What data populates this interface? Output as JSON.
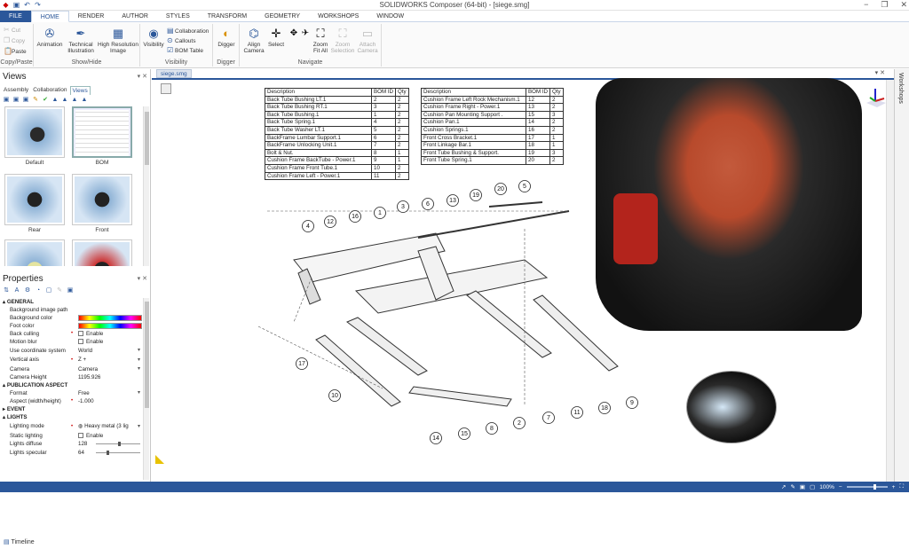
{
  "window": {
    "title": "SOLIDWORKS Composer (64-bit) - [siege.smg]",
    "minimize": "−",
    "restore": "❐",
    "close": "✕"
  },
  "ribbon_tabs": [
    "FILE",
    "HOME",
    "RENDER",
    "AUTHOR",
    "STYLES",
    "TRANSFORM",
    "GEOMETRY",
    "WORKSHOPS",
    "WINDOW"
  ],
  "ribbon": {
    "clipboard": {
      "cut": "Cut",
      "copy": "Copy",
      "paste": "Paste",
      "label": "Copy/Paste"
    },
    "showhide": {
      "animation": "Animation",
      "technical": "Technical Illustration",
      "highres": "High Resolution Image",
      "label": "Show/Hide"
    },
    "visibility": {
      "visibility": "Visibility",
      "collaboration": "Collaboration",
      "callouts": "Callouts",
      "bomtable": "BOM Table",
      "label": "Visibility"
    },
    "digger": {
      "digger": "Digger",
      "label": "Digger"
    },
    "navigate": {
      "align": "Align Camera",
      "select": "Select",
      "zoomfit": "Zoom Fit All",
      "zoomsel": "Zoom Selection",
      "attach": "Attach Camera",
      "label": "Navigate"
    }
  },
  "views_panel": {
    "title": "Views",
    "tabs": [
      "Assembly",
      "Collaboration",
      "Views"
    ],
    "thumbs": [
      "Default",
      "BOM",
      "Rear",
      "Front"
    ]
  },
  "properties": {
    "title": "Properties",
    "general": "GENERAL",
    "bg_image_path": "Background image path",
    "bg_color": "Background color",
    "foot_color": "Foot color",
    "back_culling": "Back culling",
    "back_culling_val": "Enable",
    "motion_blur": "Motion blur",
    "motion_blur_val": "Enable",
    "coord_system": "Use coordinate system",
    "coord_system_val": "World",
    "vertical_axis": "Vertical axis",
    "vertical_axis_val": "Z +",
    "camera": "Camera",
    "camera_val": "Camera",
    "camera_height": "Camera Height",
    "camera_height_val": "1195.926",
    "pub_aspect": "PUBLICATION ASPECT",
    "format": "Format",
    "format_val": "Free",
    "aspect": "Aspect (width/height)",
    "aspect_val": "-1.000",
    "event": "EVENT",
    "lights": "LIGHTS",
    "lighting_mode": "Lighting mode",
    "lighting_mode_val": "Heavy metal (3 lig",
    "static_lighting": "Static lighting",
    "static_lighting_val": "Enable",
    "lights_diffuse": "Lights diffuse",
    "lights_diffuse_val": "128",
    "lights_specular": "Lights specular",
    "lights_specular_val": "64"
  },
  "timeline": "Timeline",
  "doc_tab": "siege.smg",
  "workshops": "Workshops",
  "status": {
    "zoom": "100%"
  },
  "bom_headers": [
    "Description",
    "BOM ID",
    "Qty"
  ],
  "bom_left": [
    [
      "Back Tube Bushing LT.1",
      "2",
      "2"
    ],
    [
      "Back Tube Bushing RT.1",
      "3",
      "2"
    ],
    [
      "Back Tube Bushing.1",
      "1",
      "2"
    ],
    [
      "Back Tube Spring.1",
      "4",
      "2"
    ],
    [
      "Back Tube Washer LT.1",
      "5",
      "2"
    ],
    [
      "BackFrame Lumbar Support.1",
      "6",
      "2"
    ],
    [
      "BackFrame Unlocking Unit.1",
      "7",
      "2"
    ],
    [
      "Bolt & Nut.",
      "8",
      "1"
    ],
    [
      "Cushion Frame BackTube - Power.1",
      "9",
      "1"
    ],
    [
      "Cushion Frame Front Tube.1",
      "10",
      "2"
    ],
    [
      "Cushion Frame Left - Power.1",
      "11",
      "2"
    ]
  ],
  "bom_right": [
    [
      "Cushion Frame Left Rock Mechanism.1",
      "12",
      "2"
    ],
    [
      "Cushion Frame Right - Power.1",
      "13",
      "2"
    ],
    [
      "Cushion Pan Mounting Support .",
      "15",
      "3"
    ],
    [
      "Cushion Pan.1",
      "14",
      "2"
    ],
    [
      "Cushion Springs.1",
      "16",
      "2"
    ],
    [
      "Front Cross Bracket.1",
      "17",
      "1"
    ],
    [
      "Front Linkage Bar.1",
      "18",
      "1"
    ],
    [
      "Front Tube Bushing & Support.",
      "19",
      "3"
    ],
    [
      "Front Tube Spring.1",
      "20",
      "2"
    ]
  ],
  "callouts": [
    "4",
    "12",
    "16",
    "1",
    "3",
    "6",
    "13",
    "19",
    "20",
    "5",
    "17",
    "10",
    "14",
    "15",
    "8",
    "2",
    "7",
    "11",
    "18",
    "9"
  ]
}
